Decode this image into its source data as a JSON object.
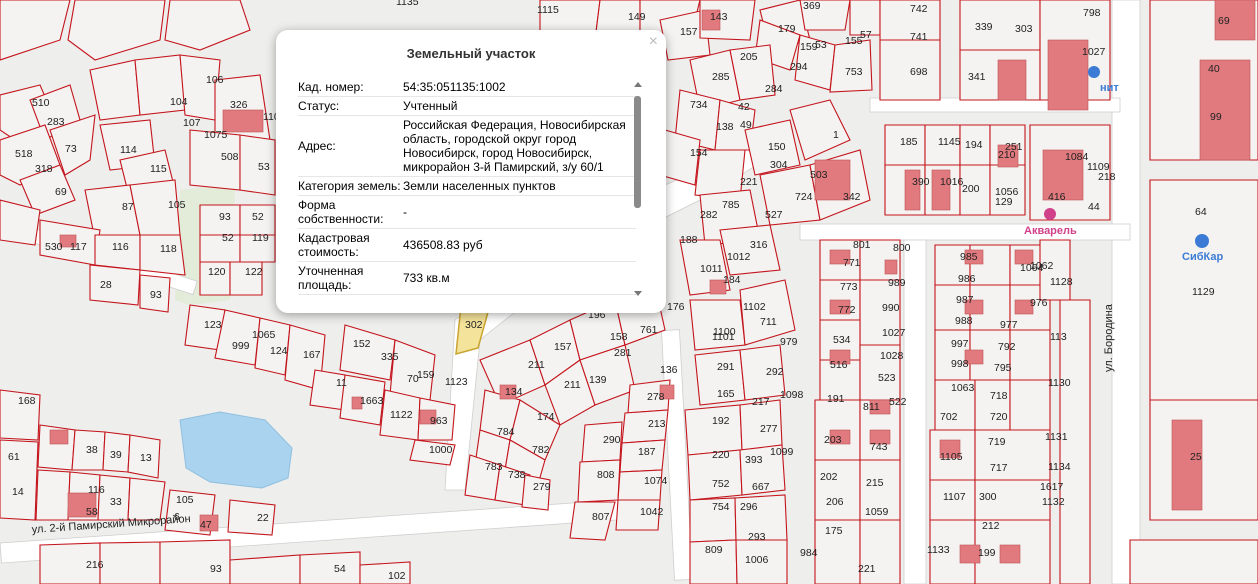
{
  "popup": {
    "title": "Земельный участок",
    "close_glyph": "×",
    "rows": [
      {
        "key": "Кад. номер:",
        "value": "54:35:051135:1002"
      },
      {
        "key": "Статус:",
        "value": "Учтенный"
      },
      {
        "key": "Адрес:",
        "value": "Российская Федерация, Новосибирская область, городской округ город Новосибирск, город Новосибирск, микрорайон 3-й Памирский, з/у 60/1"
      },
      {
        "key": "Категория земель:",
        "value": "Земли населенных пунктов"
      },
      {
        "key": "Форма собственности:",
        "value": "-"
      },
      {
        "key": "Кадастровая стоимость:",
        "value": "436508.83 руб"
      },
      {
        "key": "Уточненная площадь:",
        "value": "733 кв.м"
      }
    ]
  },
  "map": {
    "streets": {
      "pamirsky": "ул. 2-й Памирский Микрорайон",
      "borodina": "ул. Бородина"
    },
    "pois": {
      "magnit": "нит",
      "akvarel": "Акварель",
      "sibkar": "СибКар"
    },
    "colors": {
      "parcel_border": "#c4141c",
      "building": "#e07a7e",
      "selected_parcel": "#f4e39a",
      "water": "#aad3ef"
    },
    "parcel_labels": [
      "1135",
      "1115",
      "149",
      "143",
      "369",
      "798",
      "69",
      "742",
      "341",
      "339",
      "303",
      "40",
      "99",
      "1027",
      "157",
      "179",
      "159",
      "155",
      "53",
      "57",
      "741",
      "698",
      "294",
      "753",
      "205",
      "285",
      "284",
      "734",
      "42",
      "49",
      "138",
      "154",
      "1",
      "150",
      "304",
      "221",
      "503",
      "342",
      "185",
      "1145",
      "194",
      "210",
      "251",
      "390",
      "1016",
      "200",
      "1056",
      "1084",
      "1109",
      "218",
      "129",
      "416",
      "44",
      "64",
      "1129",
      "1128",
      "113",
      "114",
      "115",
      "105",
      "104",
      "106",
      "107",
      "326",
      "110",
      "1075",
      "53",
      "508",
      "510",
      "283",
      "518",
      "318",
      "69",
      "73",
      "87",
      "530",
      "117",
      "116",
      "118",
      "28",
      "93",
      "93",
      "52",
      "52",
      "119",
      "120",
      "122",
      "123",
      "999",
      "1065",
      "124",
      "167",
      "152",
      "335",
      "11",
      "1663",
      "70",
      "159",
      "1123",
      "1122",
      "963",
      "1000",
      "302",
      "282",
      "188",
      "1011",
      "1012",
      "316",
      "527",
      "724",
      "785",
      "184",
      "176",
      "196",
      "761",
      "281",
      "158",
      "157",
      "211",
      "211",
      "139",
      "136",
      "134",
      "174",
      "782",
      "784",
      "783",
      "738",
      "279",
      "278",
      "213",
      "290",
      "187",
      "1074",
      "1042",
      "808",
      "807",
      "801",
      "800",
      "771",
      "773",
      "772",
      "534",
      "516",
      "191",
      "203",
      "202",
      "206",
      "175",
      "291",
      "165",
      "192",
      "220",
      "752",
      "754",
      "809",
      "1006",
      "293",
      "296",
      "292",
      "217",
      "277",
      "393",
      "667",
      "1098",
      "1099",
      "1100",
      "1101",
      "1102",
      "711",
      "979",
      "989",
      "990",
      "1027",
      "1028",
      "523",
      "811",
      "522",
      "743",
      "215",
      "1059",
      "221",
      "984",
      "985",
      "986",
      "987",
      "988",
      "997",
      "998",
      "1063",
      "1064",
      "1062",
      "976",
      "977",
      "792",
      "795",
      "718",
      "720",
      "719",
      "717",
      "702",
      "1105",
      "1107",
      "300",
      "212",
      "199",
      "1133",
      "1132",
      "1130",
      "1131",
      "1134",
      "1617",
      "25",
      "61",
      "14",
      "38",
      "39",
      "13",
      "116",
      "58",
      "33",
      "6",
      "22",
      "47",
      "105",
      "216",
      "93",
      "102",
      "54",
      "168"
    ]
  }
}
